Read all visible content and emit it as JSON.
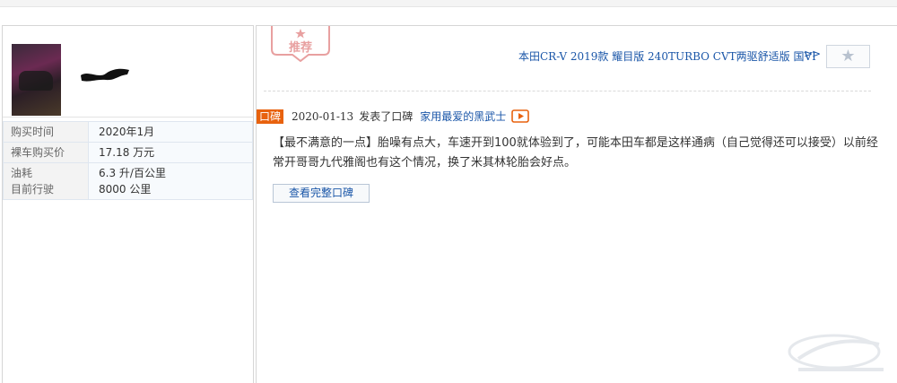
{
  "user": {
    "info": [
      {
        "label": "购买时间",
        "value": "2020年1月"
      },
      {
        "label": "裸车购买价",
        "value": "17.18 万元"
      },
      {
        "label": "油耗",
        "value": "6.3 升/百公里"
      },
      {
        "label": "目前行驶",
        "value": "8000 公里"
      }
    ]
  },
  "review": {
    "badge": "推荐",
    "car_title": "本田CR-V 2019款 耀目版 240TURBO CVT两驱舒适版 国VI",
    "more_glyph": ">>",
    "fav_glyph": "★",
    "tag": "口碑",
    "date": "2020-01-13",
    "verb": "发表了口碑",
    "title": "家用最爱的黑武士",
    "content": "【最不满意的一点】胎噪有点大，车速开到100就体验到了，可能本田车都是这样通病（自己觉得还可以接受）以前经常开哥哥九代雅阁也有这个情况，换了米其林轮胎会好点。",
    "full_link": "查看完整口碑"
  },
  "icons": {
    "video": "video-play-icon",
    "favorite": "star-icon",
    "badge": "recommend-stamp-icon"
  },
  "colors": {
    "link": "#1a56a8",
    "tag": "#e8620e",
    "stamp": "#e8a0a0"
  }
}
